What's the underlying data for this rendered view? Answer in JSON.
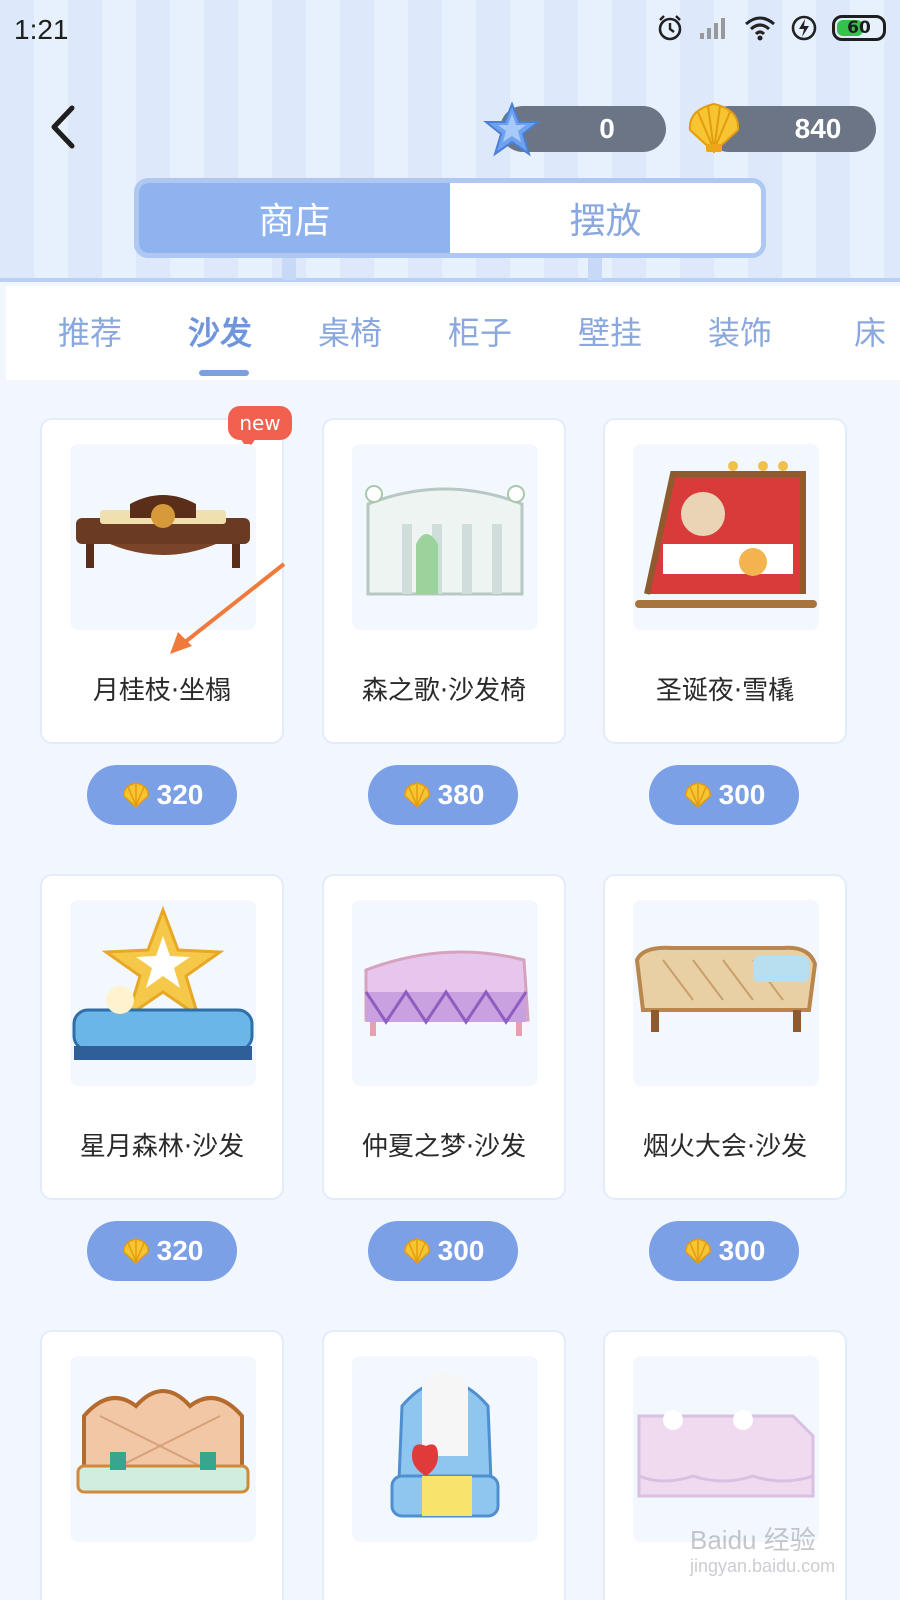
{
  "status_bar": {
    "time": "1:21",
    "battery": "60"
  },
  "currency": {
    "stars": "0",
    "shells": "840"
  },
  "segment_tabs": [
    {
      "label": "商店",
      "active": true
    },
    {
      "label": "摆放",
      "active": false
    }
  ],
  "category_tabs": [
    {
      "label": "推荐",
      "active": false
    },
    {
      "label": "沙发",
      "active": true
    },
    {
      "label": "桌椅",
      "active": false
    },
    {
      "label": "柜子",
      "active": false
    },
    {
      "label": "壁挂",
      "active": false
    },
    {
      "label": "装饰",
      "active": false
    },
    {
      "label": "床",
      "active": false
    }
  ],
  "products": [
    {
      "name": "月桂枝·坐榻",
      "price": "320",
      "badge": "new",
      "icon": "daybed-icon"
    },
    {
      "name": "森之歌·沙发椅",
      "price": "380",
      "icon": "white-bench-icon"
    },
    {
      "name": "圣诞夜·雪橇",
      "price": "300",
      "icon": "sleigh-icon"
    },
    {
      "name": "星月森林·沙发",
      "price": "320",
      "icon": "star-sofa-icon"
    },
    {
      "name": "仲夏之梦·沙发",
      "price": "300",
      "icon": "pink-sofa-icon"
    },
    {
      "name": "烟火大会·沙发",
      "price": "300",
      "icon": "rattan-sofa-icon"
    },
    {
      "name": "",
      "price": "",
      "icon": "ornate-sofa-icon"
    },
    {
      "name": "",
      "price": "",
      "icon": "armchair-icon"
    },
    {
      "name": "",
      "price": "",
      "icon": "pink-bed-icon"
    }
  ],
  "watermark": {
    "main": "Baidu 经验",
    "sub": "jingyan.baidu.com"
  },
  "colors": {
    "accent": "#7ba0e6",
    "tab_inactive": "#8aa8de",
    "price_bg": "#7ba0e6",
    "badge": "#f2604f",
    "arrow": "#f07a3c"
  }
}
